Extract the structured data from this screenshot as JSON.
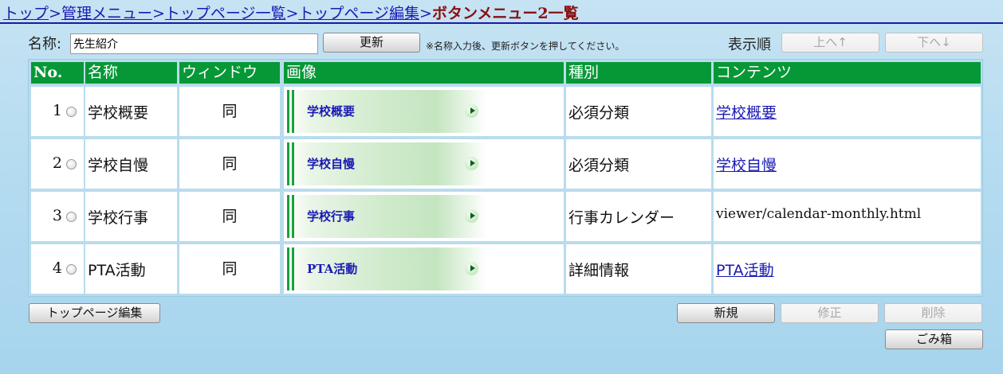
{
  "breadcrumb": {
    "links": [
      "トップ",
      "管理メニュー",
      "トップページ一覧",
      "トップページ編集"
    ],
    "separator": ">",
    "current": "ボタンメニュー2一覧"
  },
  "name_form": {
    "label": "名称:",
    "value": "先生紹介",
    "update_button": "更新",
    "note": "※名称入力後、更新ボタンを押してください。"
  },
  "order": {
    "label": "表示順",
    "up_button": "上へ↑",
    "down_button": "下へ↓"
  },
  "table": {
    "headers": [
      "No.",
      "名称",
      "ウィンドウ",
      "画像",
      "種別",
      "コンテンツ"
    ],
    "rows": [
      {
        "no": "1",
        "name": "学校概要",
        "window": "同",
        "image_label": "学校概要",
        "type": "必須分類",
        "content": "学校概要",
        "content_is_link": true
      },
      {
        "no": "2",
        "name": "学校自慢",
        "window": "同",
        "image_label": "学校自慢",
        "type": "必須分類",
        "content": "学校自慢",
        "content_is_link": true
      },
      {
        "no": "3",
        "name": "学校行事",
        "window": "同",
        "image_label": "学校行事",
        "type": "行事カレンダー",
        "content": "viewer/calendar-monthly.html",
        "content_is_link": false
      },
      {
        "no": "4",
        "name": "PTA活動",
        "window": "同",
        "image_label": "PTA活動",
        "type": "詳細情報",
        "content": "PTA活動",
        "content_is_link": true
      }
    ]
  },
  "actions": {
    "top_page_edit": "トップページ編集",
    "new": "新規",
    "modify": "修正",
    "delete": "削除",
    "trash": "ごみ箱"
  },
  "colors": {
    "header_green": "#069836",
    "link_blue": "#1a1ab4",
    "breadcrumb_current": "#8a1010"
  }
}
